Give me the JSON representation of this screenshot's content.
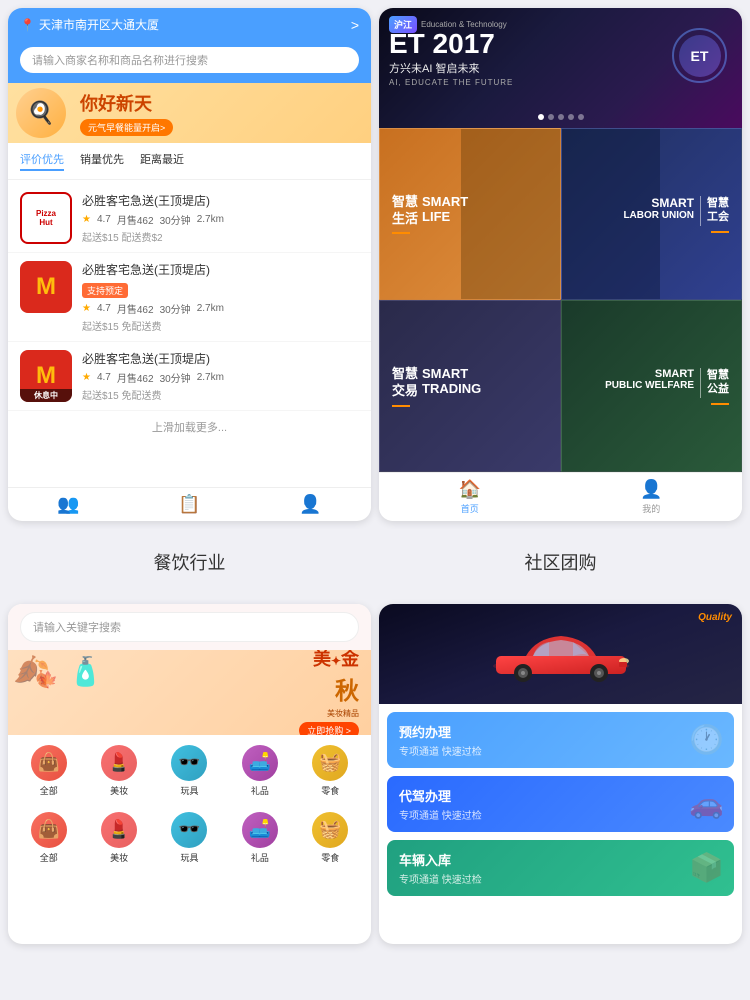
{
  "topLeft": {
    "header": {
      "location": "天津市南开区大通大厦",
      "arrow": ">"
    },
    "search": {
      "placeholder": "请输入商家名称和商品名称进行搜索"
    },
    "banner": {
      "text": "你好新天",
      "sub": "元气早餐能量开启>",
      "emoji": "🍽️"
    },
    "sortTabs": [
      {
        "label": "评价优先",
        "active": true
      },
      {
        "label": "销量优先",
        "active": false
      },
      {
        "label": "距离最近",
        "active": false
      }
    ],
    "restaurants": [
      {
        "name": "必胜客宅急送(王顶堤店)",
        "logo": "pizza",
        "rating": "4.7",
        "monthly": "月售462",
        "time": "30分钟",
        "distance": "2.7km",
        "delivery": "起送$15  配送费$2",
        "hasBadge": false,
        "isRest": false
      },
      {
        "name": "必胜客宅急送(王顶堤店)",
        "logo": "mcd",
        "rating": "4.7",
        "monthly": "月售462",
        "time": "30分钟",
        "distance": "2.7km",
        "delivery": "起送$15  免配送费",
        "hasBadge": true,
        "badgeText": "支持预定",
        "isRest": false
      },
      {
        "name": "必胜客宅急送(王顶堤店)",
        "logo": "mcd",
        "rating": "4.7",
        "monthly": "月售462",
        "time": "30分钟",
        "distance": "2.7km",
        "delivery": "起送$15  免配送费",
        "hasBadge": false,
        "isRest": true,
        "restText": "休息中"
      }
    ],
    "loadMore": "上滑加载更多...",
    "bottomNav": [
      "👥",
      "📋",
      "👤"
    ]
  },
  "topRight": {
    "banner": {
      "logoText": "沪江",
      "subText": "Education & Technology",
      "year": "ET 2017",
      "tagline": "方兴未AI 智启未来",
      "english": "AI, EDUCATE THE FUTURE",
      "circleText": "ET"
    },
    "cards": [
      {
        "zh": "智慧\n生活",
        "en": "SMART\nLIFE",
        "colorClass": "card-smart-life",
        "rightAligned": false
      },
      {
        "zh": "智慧\n工会",
        "en": "SMART\nLABOR UNION",
        "colorClass": "card-labor",
        "rightAligned": true
      },
      {
        "zh": "智慧\n交易",
        "en": "SMART\nTRADING",
        "colorClass": "card-trading",
        "rightAligned": false
      },
      {
        "zh": "智慧\n公益",
        "en": "SMART\nPUBLIC WELFARE",
        "colorClass": "card-welfare",
        "rightAligned": true
      }
    ],
    "bottomNav": [
      {
        "label": "首页",
        "icon": "🏠",
        "active": true
      },
      {
        "label": "我的",
        "icon": "👤",
        "active": false
      }
    ]
  },
  "labelLeft": "餐饮行业",
  "labelRight": "社区团购",
  "bottomLeft": {
    "search": {
      "placeholder": "请输入关键字搜索"
    },
    "banner": {
      "text": "美✦金",
      "sub": "秋",
      "smallText": "美妆精品",
      "cta": "立即抢购 >"
    },
    "icons": [
      {
        "label": "全部",
        "emoji": "👜",
        "colorClass": "icon-all"
      },
      {
        "label": "美妆",
        "emoji": "💄",
        "colorClass": "icon-makeup"
      },
      {
        "label": "玩具",
        "emoji": "🕶️",
        "colorClass": "icon-toys"
      },
      {
        "label": "礼品",
        "emoji": "🛋️",
        "colorClass": "icon-gifts"
      },
      {
        "label": "零食",
        "emoji": "🧺",
        "colorClass": "icon-food"
      }
    ],
    "iconsRow2": [
      {
        "label": "全部",
        "emoji": "👜",
        "colorClass": "icon-all"
      },
      {
        "label": "美妆",
        "emoji": "💄",
        "colorClass": "icon-makeup"
      },
      {
        "label": "玩具",
        "emoji": "🕶️",
        "colorClass": "icon-toys"
      },
      {
        "label": "礼品",
        "emoji": "🛋️",
        "colorClass": "icon-gifts"
      },
      {
        "label": "零食",
        "emoji": "🧺",
        "colorClass": "icon-food"
      }
    ]
  },
  "bottomRight": {
    "car": {
      "qualityText": "Quality"
    },
    "services": [
      {
        "title": "预约办理",
        "sub": "专项通道 快速过检",
        "colorClass": "service-item-blue",
        "icon": "🕐"
      },
      {
        "title": "代驾办理",
        "sub": "专项通道 快速过检",
        "colorClass": "service-item-dark-blue",
        "icon": "🚗"
      },
      {
        "title": "车辆入库",
        "sub": "专项通道 快速过检",
        "colorClass": "service-item-teal",
        "icon": "📦"
      }
    ]
  }
}
